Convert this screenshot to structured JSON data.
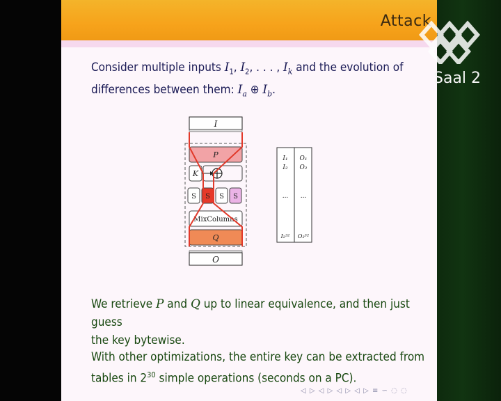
{
  "slide": {
    "frame_title": "Attack",
    "logo_text": "Saal 2",
    "para1": {
      "t1": "Consider multiple inputs ",
      "m1": "I",
      "s1": "1",
      "c1": ", ",
      "m2": "I",
      "s2": "2",
      "c2": ", . . . , ",
      "m3": "I",
      "s3": "k",
      "t2": " and the evolution of",
      "t3": "differences between them: ",
      "m4": "I",
      "s4": "a",
      "op": " ⊕ ",
      "m5": "I",
      "s5": "b",
      "t4": "."
    },
    "para2": {
      "t1": "We retrieve ",
      "p": "P",
      "t2": " and ",
      "q": "Q",
      "t3": " up to linear equivalence, and then just guess",
      "t4": "the key bytewise."
    },
    "para3": {
      "t1": "With other optimizations, the entire key can be extracted from",
      "t2": "tables in 2",
      "exp": "30",
      "t3": " simple operations (seconds on a PC)."
    },
    "diagram": {
      "input": "I",
      "p_box": "P",
      "key": "K",
      "xor": "⊕",
      "sbox": "S",
      "mixcolumns": "MixColumns",
      "q_box": "Q",
      "output": "O",
      "table": {
        "col1": [
          "I₁",
          "I₂",
          "...",
          "I₂³²"
        ],
        "col2": [
          "O₁",
          "O₂",
          "...",
          "O₂³²"
        ]
      }
    },
    "nav": "◁ ▷ ◁ ▷ ◁ ▷ ◁ ▷   ≡   ∽ ◌ ◌"
  },
  "colors": {
    "header": "#f7a31b",
    "background": "#fdf6fb",
    "title_text": "#1a1a55",
    "body_text": "#17470f",
    "highlight_red": "#e6492a",
    "sbox_pink": "#e7a7e0"
  }
}
